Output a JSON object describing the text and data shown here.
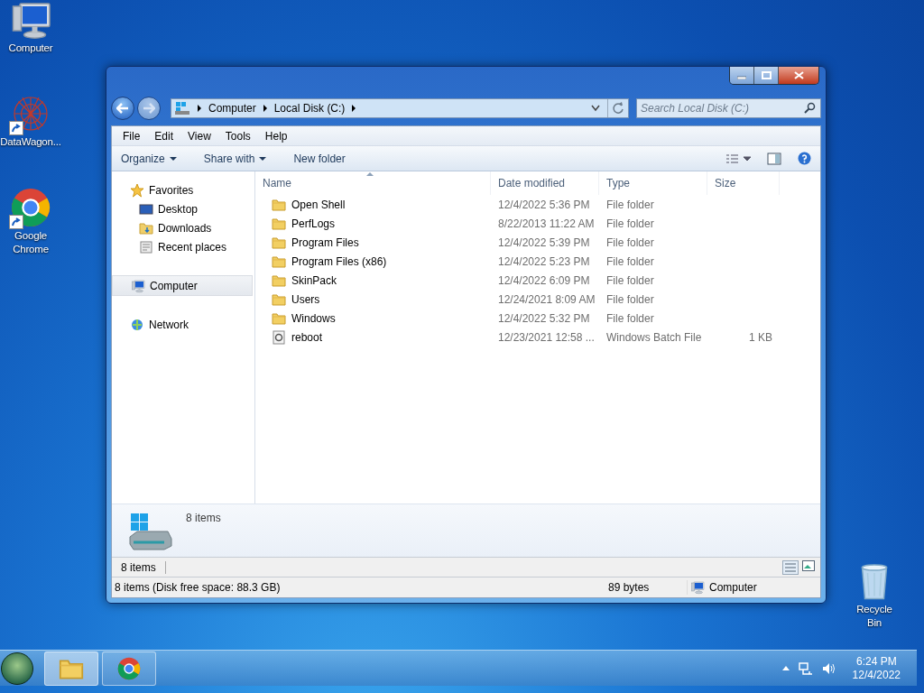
{
  "desktop_icons": [
    {
      "label": "Computer",
      "kind": "computer",
      "shortcut": false
    },
    {
      "label": "DataWagon...",
      "kind": "network-art",
      "shortcut": true
    },
    {
      "label": "Google Chrome",
      "kind": "chrome",
      "shortcut": true
    },
    {
      "label": "Recycle Bin",
      "kind": "recycle",
      "shortcut": false
    }
  ],
  "window": {
    "address": {
      "crumbs": [
        "Computer",
        "Local Disk (C:)"
      ]
    },
    "search": {
      "placeholder": "Search Local Disk (C:)"
    },
    "menu": [
      "File",
      "Edit",
      "View",
      "Tools",
      "Help"
    ],
    "toolbar": [
      {
        "label": "Organize",
        "dropdown": true
      },
      {
        "label": "Share with",
        "dropdown": true
      },
      {
        "label": "New folder",
        "dropdown": false
      }
    ],
    "sidebar": [
      {
        "label": "Favorites",
        "kind": "star",
        "selected": false,
        "children": [
          {
            "label": "Desktop",
            "kind": "desktop",
            "selected": false
          },
          {
            "label": "Downloads",
            "kind": "downloads",
            "selected": false
          },
          {
            "label": "Recent places",
            "kind": "recent",
            "selected": false
          }
        ]
      },
      {
        "label": "Computer",
        "kind": "computer",
        "selected": true
      },
      {
        "label": "Network",
        "kind": "network",
        "selected": false
      }
    ],
    "columns": [
      {
        "label": "Name",
        "sorted": true
      },
      {
        "label": "Date modified",
        "sorted": false
      },
      {
        "label": "Type",
        "sorted": false
      },
      {
        "label": "Size",
        "sorted": false
      }
    ],
    "rows": [
      {
        "kind": "folder",
        "name": "Open Shell",
        "date": "12/4/2022 5:36 PM",
        "type": "File folder"
      },
      {
        "kind": "folder",
        "name": "PerfLogs",
        "date": "8/22/2013 11:22 AM",
        "type": "File folder"
      },
      {
        "kind": "folder",
        "name": "Program Files",
        "date": "12/4/2022 5:39 PM",
        "type": "File folder"
      },
      {
        "kind": "folder",
        "name": "Program Files (x86)",
        "date": "12/4/2022 5:23 PM",
        "type": "File folder"
      },
      {
        "kind": "folder",
        "name": "SkinPack",
        "date": "12/4/2022 6:09 PM",
        "type": "File folder"
      },
      {
        "kind": "folder",
        "name": "Users",
        "date": "12/24/2021 8:09 AM",
        "type": "File folder"
      },
      {
        "kind": "folder",
        "name": "Windows",
        "date": "12/4/2022 5:32 PM",
        "type": "File folder"
      },
      {
        "kind": "batch",
        "name": "reboot",
        "date": "12/23/2021 12:58 ...",
        "type": "Windows Batch File",
        "size": "1 KB"
      }
    ],
    "details_pane": {
      "summary": "8 items"
    },
    "status": {
      "items": "8 items"
    },
    "status_bar": {
      "info": "8 items (Disk free space: 88.3 GB)",
      "size": "89 bytes",
      "location": "Computer"
    }
  },
  "taskbar": {
    "apps": [
      {
        "kind": "explorer",
        "selected": true
      },
      {
        "kind": "chrome",
        "selected": false
      }
    ],
    "time": "6:24 PM",
    "date": "12/4/2022"
  }
}
